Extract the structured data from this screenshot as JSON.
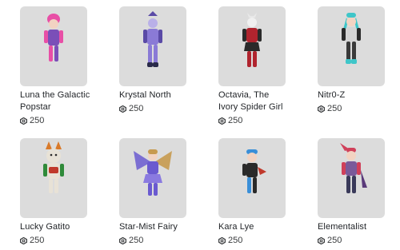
{
  "currency_icon": "robux-icon",
  "items": [
    {
      "name_line1": "Luna the Galactic",
      "name_line2": "Popstar",
      "price": "250",
      "accent": "#e84fa6",
      "accent2": "#7a4fb8"
    },
    {
      "name_line1": "Krystal North",
      "name_line2": "",
      "price": "250",
      "accent": "#8a7ad6",
      "accent2": "#5a4aa6"
    },
    {
      "name_line1": "Octavia, The",
      "name_line2": "Ivory Spider Girl",
      "price": "250",
      "accent": "#b0242e",
      "accent2": "#2a2a2a"
    },
    {
      "name_line1": "Nitr0-Z",
      "name_line2": "",
      "price": "250",
      "accent": "#3fc6c9",
      "accent2": "#d4d4d4"
    },
    {
      "name_line1": "Lucky Gatito",
      "name_line2": "",
      "price": "250",
      "accent": "#e8e2d6",
      "accent2": "#2f8a3a"
    },
    {
      "name_line1": "Star-Mist Fairy",
      "name_line2": "",
      "price": "250",
      "accent": "#c79a4f",
      "accent2": "#6a5ad0"
    },
    {
      "name_line1": "Kara Lye",
      "name_line2": "",
      "price": "250",
      "accent": "#3a8fd8",
      "accent2": "#c0392b"
    },
    {
      "name_line1": "Elementalist",
      "name_line2": "",
      "price": "250",
      "accent": "#d0405a",
      "accent2": "#7a5a9a"
    }
  ]
}
